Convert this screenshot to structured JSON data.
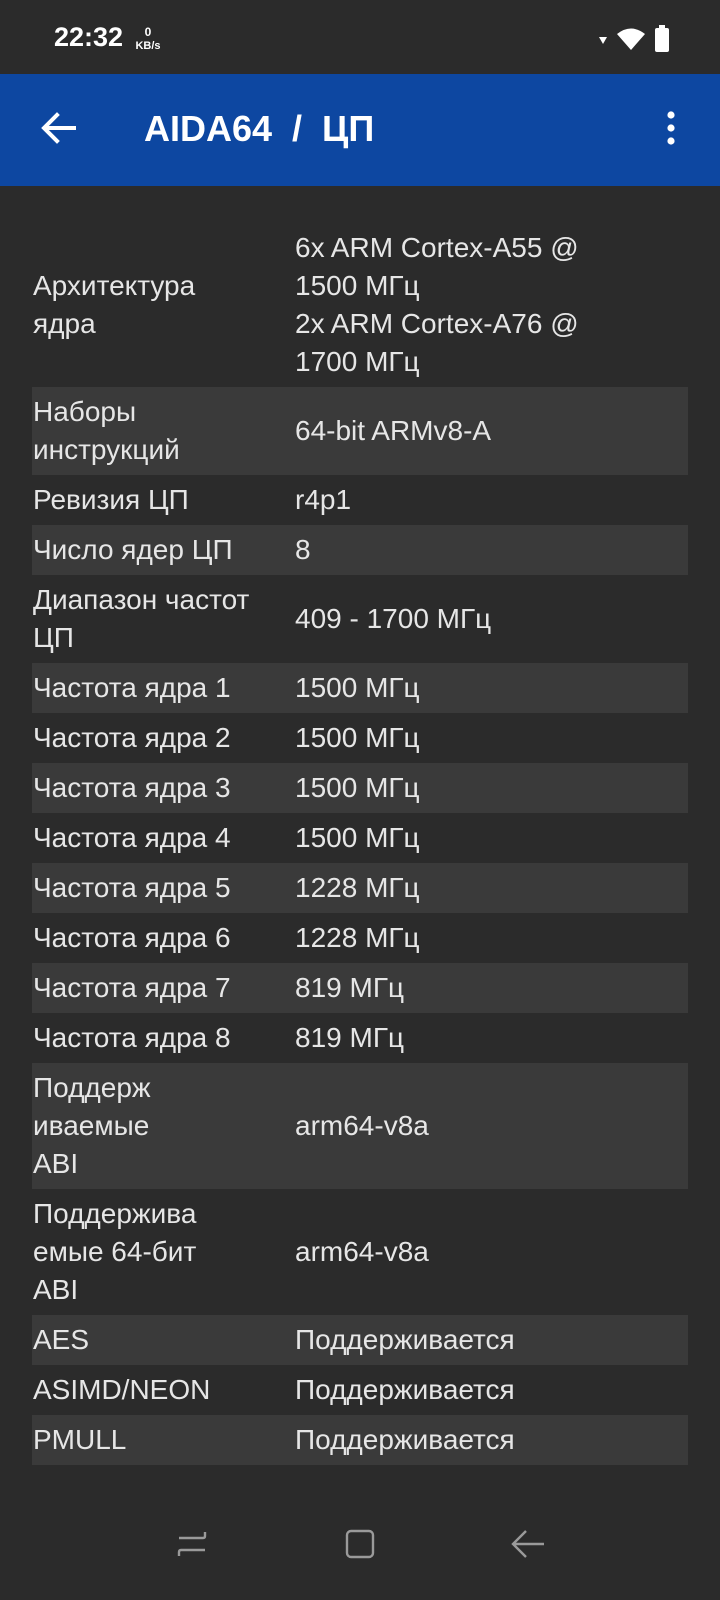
{
  "status_bar": {
    "time": "22:32",
    "net_speed_value": "0",
    "net_speed_unit": "KB/s",
    "icons": [
      "signal-arrow-icon",
      "wifi-icon",
      "battery-icon"
    ]
  },
  "app_bar": {
    "title": "AIDA64  /  ЦП",
    "back_icon": "arrow-left-icon",
    "menu_icon": "more-vert-icon",
    "background": "#0d47a1"
  },
  "rows": [
    {
      "label": [
        "Архитектура",
        "ядра"
      ],
      "value": [
        "6x ARM Cortex-A55 @",
        "1500 МГц",
        "2x ARM Cortex-A76 @",
        "1700 МГц"
      ]
    },
    {
      "label": [
        "Наборы",
        "инструкций"
      ],
      "value": [
        "64-bit ARMv8-A"
      ]
    },
    {
      "label": [
        "Ревизия ЦП"
      ],
      "value": [
        "r4p1"
      ]
    },
    {
      "label": [
        "Число ядер ЦП"
      ],
      "value": [
        "8"
      ]
    },
    {
      "label": [
        "Диапазон частот",
        "ЦП"
      ],
      "value": [
        "409 - 1700 МГц"
      ]
    },
    {
      "label": [
        "Частота ядра 1"
      ],
      "value": [
        "1500 МГц"
      ]
    },
    {
      "label": [
        "Частота ядра 2"
      ],
      "value": [
        "1500 МГц"
      ]
    },
    {
      "label": [
        "Частота ядра 3"
      ],
      "value": [
        "1500 МГц"
      ]
    },
    {
      "label": [
        "Частота ядра 4"
      ],
      "value": [
        "1500 МГц"
      ]
    },
    {
      "label": [
        "Частота ядра 5"
      ],
      "value": [
        "1228 МГц"
      ]
    },
    {
      "label": [
        "Частота ядра 6"
      ],
      "value": [
        "1228 МГц"
      ]
    },
    {
      "label": [
        "Частота ядра 7"
      ],
      "value": [
        "819 МГц"
      ]
    },
    {
      "label": [
        "Частота ядра 8"
      ],
      "value": [
        "819 МГц"
      ]
    },
    {
      "label": [
        "Поддерж",
        "иваемые",
        "ABI"
      ],
      "value": [
        "arm64-v8a"
      ]
    },
    {
      "label": [
        "Поддержива",
        "емые 64-бит",
        "ABI"
      ],
      "value": [
        "arm64-v8a"
      ]
    },
    {
      "label": [
        "AES"
      ],
      "value": [
        "Поддерживается"
      ]
    },
    {
      "label": [
        "ASIMD/NEON"
      ],
      "value": [
        "Поддерживается"
      ]
    },
    {
      "label": [
        "PMULL"
      ],
      "value": [
        "Поддерживается"
      ]
    }
  ],
  "nav_bar": {
    "icons": [
      "recent-apps-icon",
      "home-icon",
      "back-icon"
    ]
  }
}
